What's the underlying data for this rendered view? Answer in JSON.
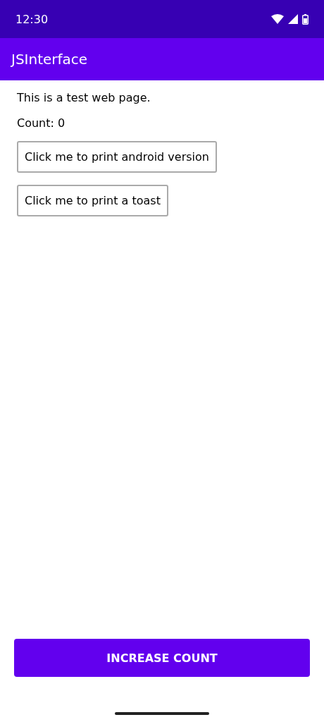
{
  "status_bar": {
    "time": "12:30"
  },
  "app_bar": {
    "title": "JSInterface"
  },
  "web_page": {
    "paragraphs": [
      "This is a test web page.",
      "Count: 0"
    ],
    "buttons": [
      "Click me to print android version",
      "Click me to print a toast"
    ]
  },
  "bottom_button": "INCREASE COUNT"
}
